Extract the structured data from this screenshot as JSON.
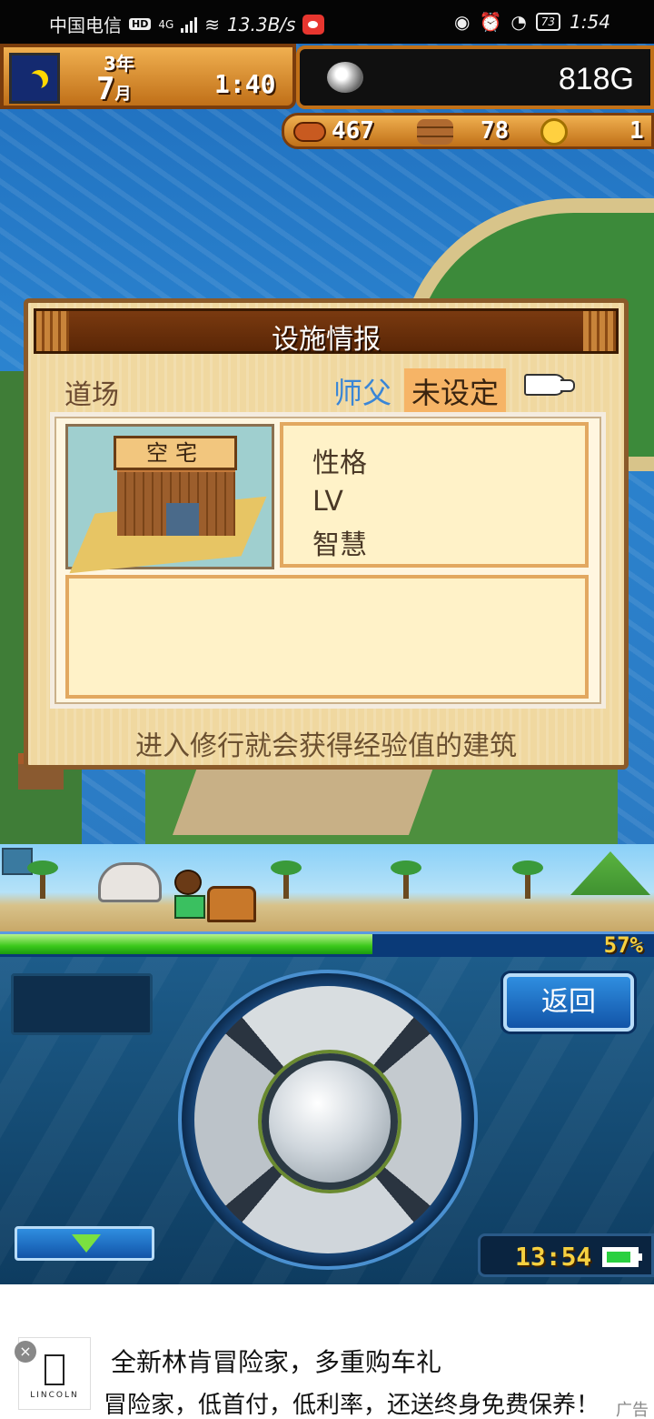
{
  "status_bar": {
    "carrier": "中国电信",
    "hd": "HD",
    "network": "4G",
    "speed": "13.3B/s",
    "battery": "73",
    "time": "1:54"
  },
  "hud": {
    "year": "3年",
    "month": "7",
    "month_unit": "月",
    "game_time": "1:40",
    "money": "818G",
    "food": "467",
    "wood": "78",
    "medals": "1"
  },
  "dialog": {
    "title": "设施情报",
    "facility_name": "道场",
    "master_label": "师父",
    "master_value": "未设定",
    "building_label": "空宅",
    "stat_personality": "性格",
    "stat_lv": "LV",
    "stat_wisdom": "智慧",
    "description": "进入修行就会获得经验值的建筑"
  },
  "progress": {
    "percent": 57,
    "label": "57%"
  },
  "controls": {
    "back_label": "返回",
    "clock": "13:54"
  },
  "ad": {
    "brand": "LINCOLN",
    "line1": "全新林肯冒险家，多重购车礼",
    "line2": "冒险家，低首付，低利率，还送终身免费保养！",
    "tag": "广告",
    "close": "×"
  },
  "colors": {
    "hud_orange": "#e09030",
    "panel_blue": "#1d5c8a",
    "progress_green": "#3ac81a",
    "master_blue": "#3a86d6"
  }
}
